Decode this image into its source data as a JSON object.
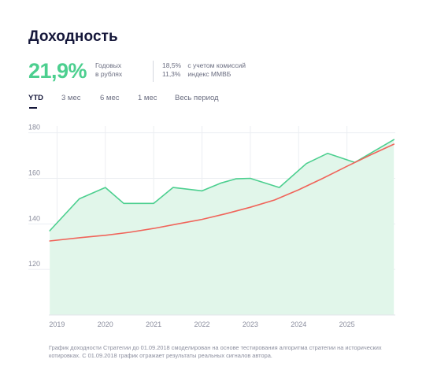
{
  "title": "Доходность",
  "summary": {
    "annual_yield": "21,9%",
    "annual_caption_line1": "Годовых",
    "annual_caption_line2": "в рублях",
    "metrics": [
      {
        "value": "18,5%",
        "label": "с учетом комиссий"
      },
      {
        "value": "11,3%",
        "label": "индекс ММВБ"
      }
    ]
  },
  "tabs": [
    {
      "label": "YTD",
      "active": true
    },
    {
      "label": "3 мес",
      "active": false
    },
    {
      "label": "6 мес",
      "active": false
    },
    {
      "label": "1 мес",
      "active": false
    },
    {
      "label": "Весь период",
      "active": false
    }
  ],
  "chart_data": {
    "type": "area",
    "xlim": [
      2018.83,
      2026.0
    ],
    "ylim": [
      100,
      183
    ],
    "x_ticks": [
      2019,
      2020,
      2021,
      2022,
      2023,
      2024,
      2025
    ],
    "x_tick_labels": [
      "2019",
      "2020",
      "2021",
      "2022",
      "2023",
      "2024",
      "2025"
    ],
    "y_ticks": [
      120,
      140,
      160,
      180
    ],
    "y_tick_labels": [
      "120",
      "140",
      "160",
      "180"
    ],
    "grid": {
      "vertical": true,
      "horizontal": true
    },
    "series": [
      {
        "color": "#4ccf8f",
        "fill": "#e1f6ea",
        "style": "area",
        "x": [
          2018.85,
          2019.46,
          2020.0,
          2020.38,
          2021.0,
          2021.4,
          2022.0,
          2022.4,
          2022.7,
          2023.0,
          2023.6,
          2024.16,
          2024.6,
          2025.16,
          2025.97
        ],
        "y": [
          137,
          151,
          156,
          149,
          149,
          156,
          154.5,
          158,
          159.8,
          160,
          156,
          166.5,
          171,
          167,
          177
        ]
      },
      {
        "color": "#f0645a",
        "style": "line",
        "x": [
          2018.85,
          2019.5,
          2020.0,
          2020.5,
          2021.0,
          2021.5,
          2022.0,
          2022.5,
          2023.0,
          2023.5,
          2024.0,
          2024.5,
          2025.0,
          2025.5,
          2025.97
        ],
        "y": [
          132.5,
          134,
          135,
          136.3,
          138,
          140,
          142,
          144.5,
          147.3,
          150.5,
          155,
          160,
          165.3,
          170.4,
          175
        ]
      }
    ]
  },
  "note": "График доходности Стратегии до 01.09.2018 смоделирован на основе тестирования алгоритма стратегии на исторических котировках. С 01.09.2018 график отражает результаты реальных сигналов автора."
}
